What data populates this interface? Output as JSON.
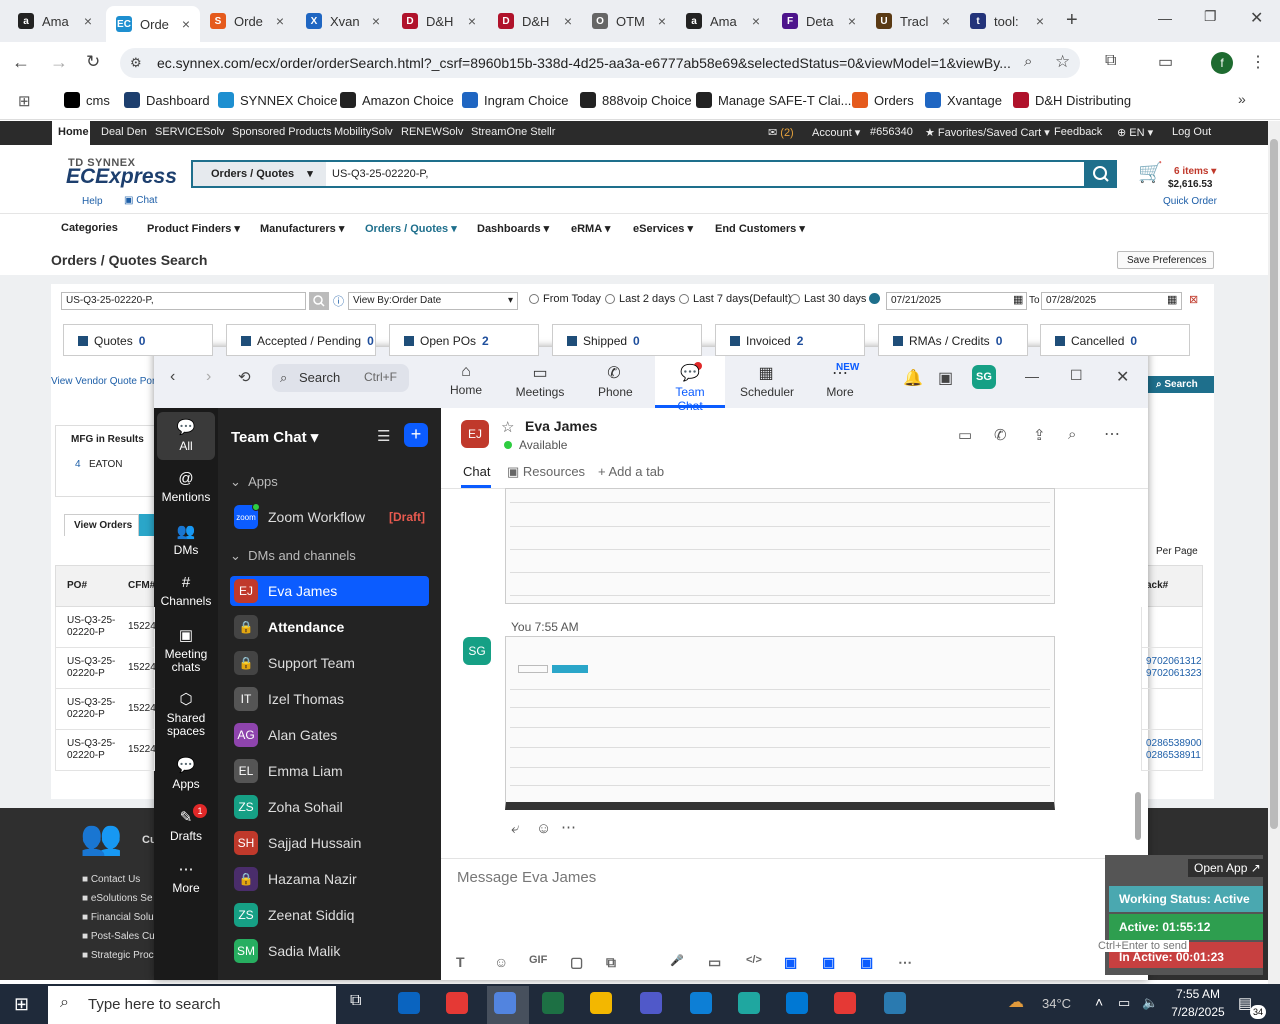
{
  "browser": {
    "tabs": [
      {
        "label": "Ama",
        "color": "#222",
        "glyph": "a"
      },
      {
        "label": "Orde",
        "color": "#1e8fd0",
        "glyph": "EC"
      },
      {
        "label": "Orde",
        "color": "#e55a1c",
        "glyph": "S"
      },
      {
        "label": "Xvan",
        "color": "#1f66c2",
        "glyph": "X"
      },
      {
        "label": "D&H",
        "color": "#b0122b",
        "glyph": "D"
      },
      {
        "label": "D&H",
        "color": "#b0122b",
        "glyph": "D"
      },
      {
        "label": "OTM",
        "color": "#666",
        "glyph": "O"
      },
      {
        "label": "Ama",
        "color": "#222",
        "glyph": "a"
      },
      {
        "label": "Deta",
        "color": "#4d148c",
        "glyph": "F"
      },
      {
        "label": "Tracl",
        "color": "#5a3a14",
        "glyph": "U"
      },
      {
        "label": "tool:",
        "color": "#23337a",
        "glyph": "t"
      }
    ],
    "url": "ec.synnex.com/ecx/order/orderSearch.html?_csrf=8960b15b-338d-4d25-aa3a-e6777ab58e69&selectedStatus=0&viewModel=1&viewBy...",
    "profile_initial": "f",
    "bookmarks": [
      "cms",
      "Dashboard",
      "SYNNEX Choice",
      "Amazon Choice",
      "Ingram Choice",
      "888voip Choice",
      "Manage SAFE-T Clai...",
      "Orders",
      "Xvantage",
      "D&H Distributing"
    ]
  },
  "synnex": {
    "topnav_left": [
      "Home",
      "Deal Den",
      "SERVICESolv",
      "Sponsored Products",
      "MobilitySolv",
      "RENEWSolv",
      "StreamOne Stellr"
    ],
    "mail_count": "(2)",
    "account": "Account",
    "account_no": "#656340",
    "favorites": "Favorites/Saved Cart",
    "feedback": "Feedback",
    "lang": "EN",
    "logout": "Log Out",
    "logo_top": "TD SYNNEX",
    "logo_main": "ECExpress",
    "help": "Help",
    "chat": "Chat",
    "search_scope": "Orders / Quotes",
    "search_value": "US-Q3-25-02220-P,",
    "cart_items": "6 items",
    "cart_total": "$2,616.53",
    "quick_order": "Quick Order",
    "menu": [
      "Categories",
      "Product Finders",
      "Manufacturers",
      "Orders / Quotes",
      "Dashboards",
      "eRMA",
      "eServices",
      "End Customers"
    ],
    "page_title": "Orders / Quotes Search",
    "save_prefs": "Save Preferences",
    "po_input": "US-Q3-25-02220-P,",
    "view_by": "View By:Order Date",
    "ranges": [
      "From Today",
      "Last 2 days",
      "Last 7 days(Default)",
      "Last 30 days"
    ],
    "date_from": "07/21/2025",
    "to_label": "To",
    "date_to": "07/28/2025",
    "filters": [
      {
        "label": "Quotes",
        "count": "0"
      },
      {
        "label": "Accepted / Pending",
        "count": "0"
      },
      {
        "label": "Open POs",
        "count": "2"
      },
      {
        "label": "Shipped",
        "count": "0"
      },
      {
        "label": "Invoiced",
        "count": "2"
      },
      {
        "label": "RMAs / Credits",
        "count": "0"
      },
      {
        "label": "Cancelled",
        "count": "0"
      }
    ],
    "vendor_quote": "View Vendor Quote Port",
    "search_btn": "Search",
    "mfg_title": "MFG in Results",
    "mfg_count": "4",
    "mfg_name": "EATON",
    "view_orders": "View Orders",
    "per_page": "Per Page",
    "col_po": "PO#",
    "col_cfm": "CFM#",
    "col_track": "ack#",
    "rows": [
      {
        "po1": "US-Q3-25-",
        "po2": "02220-P",
        "cfm": "15224",
        "t1": "",
        "t2": ""
      },
      {
        "po1": "US-Q3-25-",
        "po2": "02220-P",
        "cfm": "15224",
        "t1": "9702061312",
        "t2": "9702061323"
      },
      {
        "po1": "US-Q3-25-",
        "po2": "02220-P",
        "cfm": "15224",
        "t1": "",
        "t2": ""
      },
      {
        "po1": "US-Q3-25-",
        "po2": "02220-P",
        "cfm": "15224",
        "t1": "0286538900",
        "t2": "0286538911"
      }
    ],
    "footer_links": [
      "Contact Us",
      "eSolutions Se",
      "Financial Solu",
      "Post-Sales Cu",
      "Strategic Proc"
    ],
    "footer_cu": "Cu"
  },
  "zoom": {
    "search": "Search",
    "search_shortcut": "Ctrl+F",
    "nav": [
      "Home",
      "Meetings",
      "Phone",
      "Team Chat",
      "Scheduler",
      "More"
    ],
    "new_badge": "NEW",
    "user_initials": "SG",
    "side": [
      "All",
      "Mentions",
      "DMs",
      "Channels",
      "Meeting chats",
      "Shared spaces",
      "Apps",
      "Drafts",
      "More"
    ],
    "drafts_badge": "1",
    "panel_title": "Team Chat",
    "apps_label": "Apps",
    "workflow": "Zoom Workflow",
    "draft_tag": "[Draft]",
    "dms_label": "DMs and channels",
    "contacts": [
      {
        "name": "Eva James",
        "initials": "EJ",
        "color": "#c0392b"
      },
      {
        "name": "Attendance",
        "initials": "",
        "color": "#444"
      },
      {
        "name": "Support Team",
        "initials": "",
        "color": "#444"
      },
      {
        "name": "Izel Thomas",
        "initials": "IT",
        "color": "#555"
      },
      {
        "name": "Alan Gates",
        "initials": "AG",
        "color": "#8e44ad"
      },
      {
        "name": "Emma Liam",
        "initials": "EL",
        "color": "#555"
      },
      {
        "name": "Zoha Sohail",
        "initials": "ZS",
        "color": "#16a085"
      },
      {
        "name": "Sajjad Hussain",
        "initials": "SH",
        "color": "#c0392b"
      },
      {
        "name": "Hazama Nazir",
        "initials": "",
        "color": "#4a2d6b"
      },
      {
        "name": "Zeenat Siddiq",
        "initials": "ZS",
        "color": "#16a085"
      },
      {
        "name": "Sadia Malik",
        "initials": "SM",
        "color": "#27ae60"
      }
    ],
    "chat_name": "Eva James",
    "chat_initials": "EJ",
    "chat_status": "Available",
    "chat_tabs": [
      "Chat",
      "Resources",
      "Add a tab"
    ],
    "you_label": "You 7:55 AM",
    "message_placeholder": "Message Eva James",
    "open_app": "Open App",
    "working_status": "Working Status: Active",
    "active_time": "Active: 01:55:12",
    "inactive_time": "In Active: 00:01:23",
    "enter_hint": "Ctrl+Enter to send"
  },
  "taskbar": {
    "search": "Type here to search",
    "temp": "34°C",
    "time": "7:55 AM",
    "date": "7/28/2025",
    "notif": "34"
  }
}
